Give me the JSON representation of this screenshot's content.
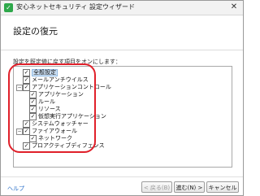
{
  "window": {
    "title": "安心ネットセキュリティ 設定ウィザード",
    "app_icon": "shield-icon",
    "close_label": "✕"
  },
  "page": {
    "title": "設定の復元",
    "instruction": "設定を既定値に戻す項目をオンにします："
  },
  "tree": [
    {
      "label": "全般設定",
      "checked": true,
      "selected": true
    },
    {
      "label": "メールアンチウイルス",
      "checked": true
    },
    {
      "label": "アプリケーションコントロール",
      "checked": true,
      "expanded": true
    },
    {
      "label": "アプリケーション",
      "checked": true
    },
    {
      "label": "ルール",
      "checked": true
    },
    {
      "label": "リソース",
      "checked": true
    },
    {
      "label": "仮想実行アプリケーション",
      "checked": true
    },
    {
      "label": "システムウォッチャー",
      "checked": true
    },
    {
      "label": "ファイアウォール",
      "checked": true,
      "expanded": true
    },
    {
      "label": "ネットワーク",
      "checked": true
    },
    {
      "label": "プロアクティブディフェンス",
      "checked": true
    }
  ],
  "footer": {
    "help": "ヘルプ",
    "back": "< 戻る(B)",
    "next": "進む(N) >",
    "cancel": "キャンセル"
  },
  "colors": {
    "highlight": "#e0202a",
    "link": "#2a6fc9"
  }
}
